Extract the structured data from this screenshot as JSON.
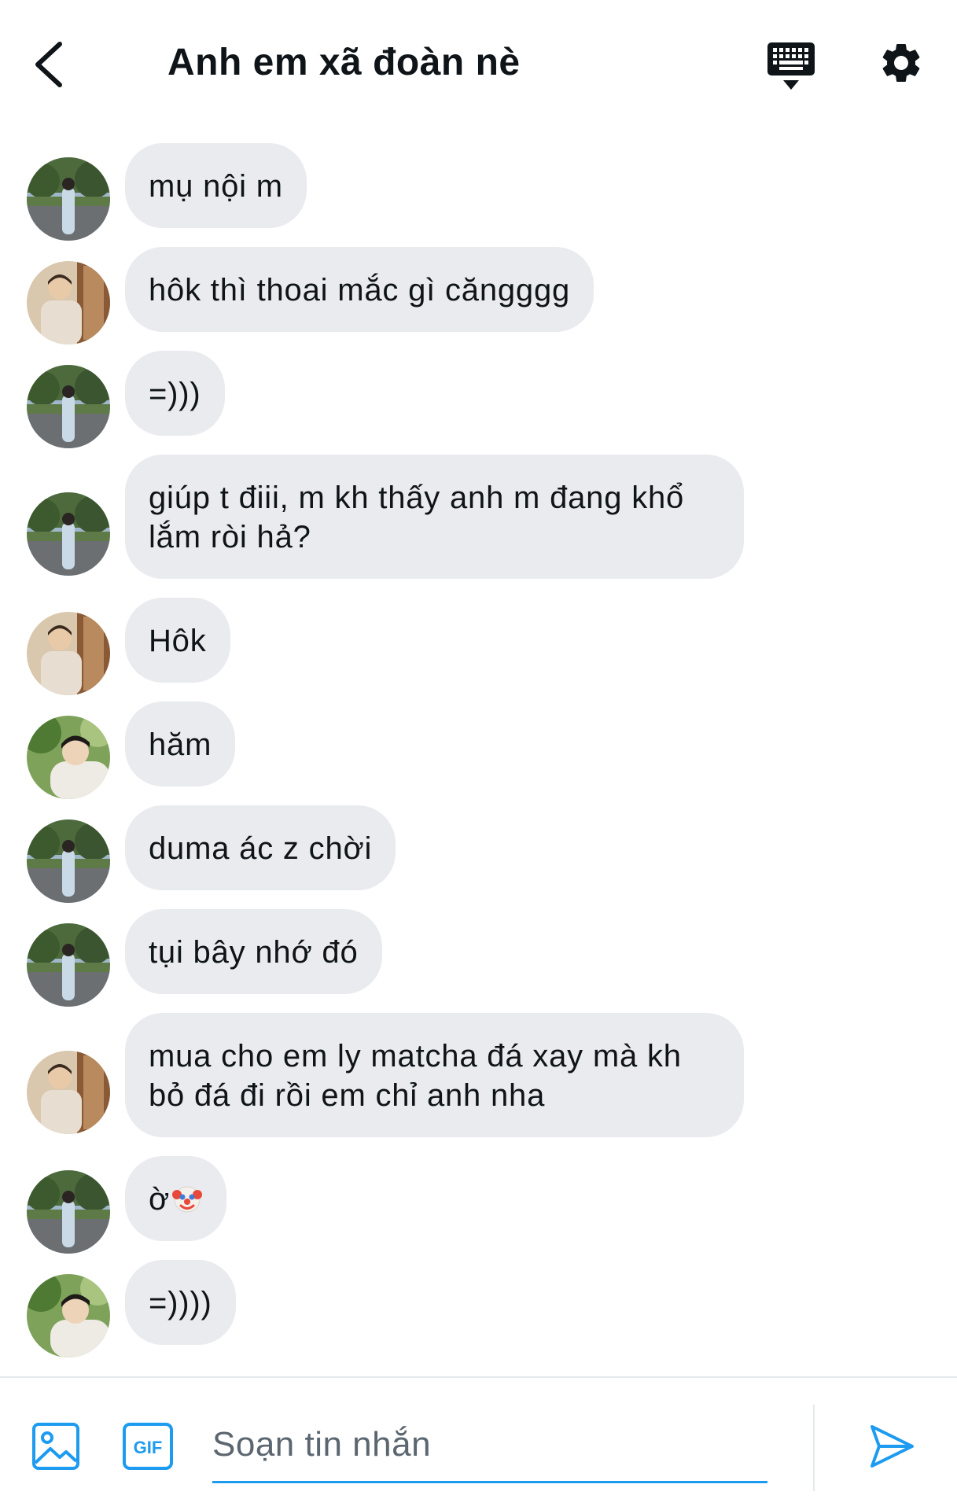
{
  "header": {
    "title": "Anh em xã đoàn nè",
    "icons": {
      "back": "chevron-left-icon",
      "keyboard": "keyboard-icon",
      "settings": "gear-icon"
    }
  },
  "messages": [
    {
      "avatar": "avatar-park",
      "text": "mụ nội m"
    },
    {
      "avatar": "avatar-window",
      "text": "hôk thì thoai mắc gì căngggg"
    },
    {
      "avatar": "avatar-park",
      "text": "=)))"
    },
    {
      "avatar": "avatar-park",
      "text": "giúp t điii, m kh thấy anh m đang khổ lắm ròi hả?"
    },
    {
      "avatar": "avatar-window",
      "text": "Hôk"
    },
    {
      "avatar": "avatar-trees",
      "text": "hăm"
    },
    {
      "avatar": "avatar-park",
      "text": "duma ác z chời"
    },
    {
      "avatar": "avatar-park",
      "text": "tụi bây nhớ đó"
    },
    {
      "avatar": "avatar-window",
      "text": "mua cho em ly matcha đá xay mà kh bỏ đá đi rồi em chỉ anh nha"
    },
    {
      "avatar": "avatar-park",
      "text": "ờ",
      "emoji": "clown-face-emoji"
    },
    {
      "avatar": "avatar-trees",
      "text": "=))))"
    }
  ],
  "composer": {
    "placeholder": "Soạn tin nhắn",
    "gif_label": "GIF",
    "icons": {
      "image": "image-icon",
      "gif": "gif-icon",
      "send": "send-icon"
    }
  },
  "colors": {
    "accent": "#1d9bf0",
    "bubble": "#e9ebef",
    "text": "#0f1419",
    "placeholder": "#5b6670"
  }
}
